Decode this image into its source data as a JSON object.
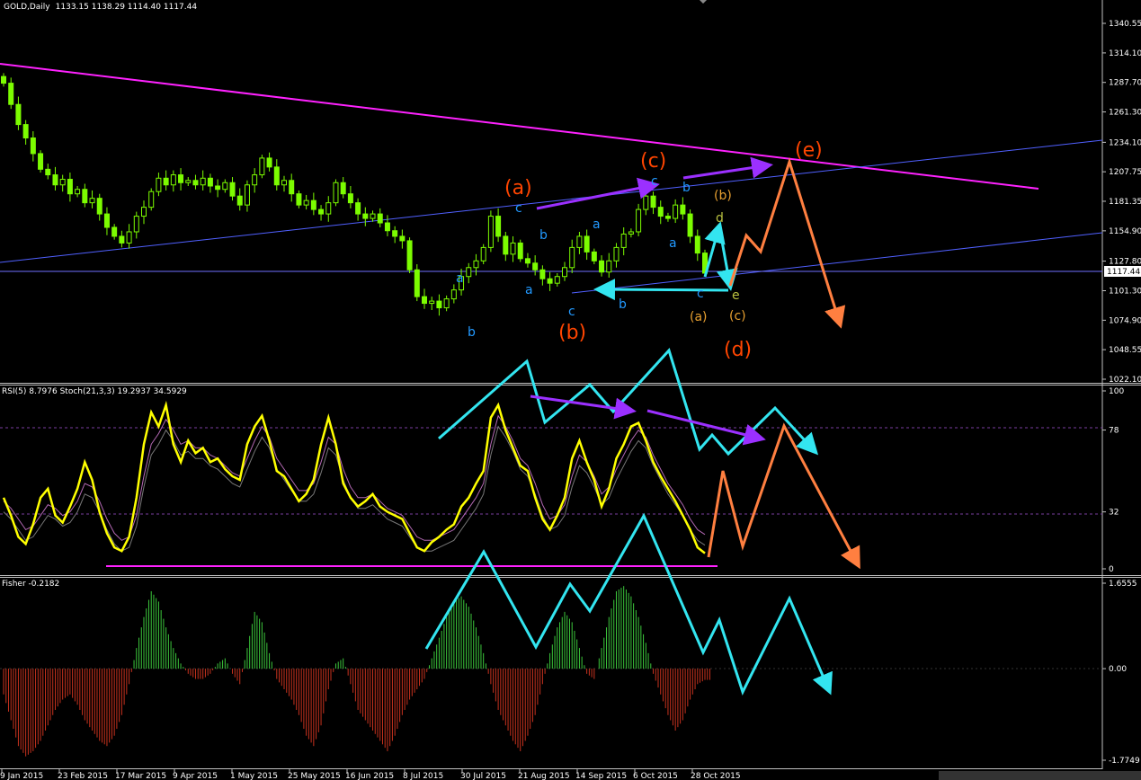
{
  "window": {
    "symbol": "GOLD,Daily",
    "ohlc": "1133.15 1138.29 1114.40 1117.44",
    "current_price": "1117.44"
  },
  "colors": {
    "background": "#000000",
    "frame": "#c0c0c0",
    "bull_candle": "#7cfc00",
    "rsi_line": "#ffff00",
    "stoch_line": "#b469b4",
    "fisher_pos": "#3cc83c",
    "fisher_neg": "#c8321e",
    "resistance_line": "#ff22ff",
    "channel_line": "#5060ff",
    "wave_main": "#ff4500",
    "wave_minor": "#2299ff",
    "wave_sub": "#e8a030",
    "wave_sub2": "#b8c040",
    "arrow_cyan": "#33e5f0",
    "arrow_orange": "#ff7f40",
    "arrow_purple": "#9b30ff"
  },
  "chart_data": [
    {
      "type": "candlestick",
      "title": "GOLD,Daily",
      "header_values": "1133.15 1138.29 1114.40 1117.44",
      "y_ticks": [
        "1340.55",
        "1314.10",
        "1287.70",
        "1261.30",
        "1234.10",
        "1207.75",
        "1181.35",
        "1154.90",
        "1127.80",
        "1101.30",
        "1074.90",
        "1048.55",
        "1022.10"
      ],
      "ylim": [
        1022.1,
        1340.55
      ],
      "current_price": 1117.44,
      "close_series": [
        1287,
        1268,
        1250,
        1238,
        1224,
        1210,
        1205,
        1196,
        1201,
        1188,
        1192,
        1180,
        1184,
        1170,
        1158,
        1150,
        1144,
        1154,
        1168,
        1176,
        1190,
        1202,
        1196,
        1205,
        1198,
        1200,
        1196,
        1202,
        1195,
        1192,
        1198,
        1186,
        1178,
        1196,
        1205,
        1220,
        1212,
        1196,
        1200,
        1188,
        1178,
        1182,
        1174,
        1170,
        1180,
        1198,
        1188,
        1180,
        1170,
        1166,
        1170,
        1162,
        1155,
        1150,
        1146,
        1120,
        1096,
        1090,
        1092,
        1086,
        1094,
        1102,
        1114,
        1122,
        1128,
        1140,
        1168,
        1150,
        1134,
        1144,
        1130,
        1126,
        1120,
        1112,
        1108,
        1114,
        1122,
        1140,
        1150,
        1136,
        1128,
        1118,
        1128,
        1140,
        1152,
        1154,
        1174,
        1186,
        1176,
        1168,
        1166,
        1178,
        1170,
        1150,
        1135,
        1117
      ],
      "wave_labels": [
        {
          "text": "(a)",
          "series": "primary"
        },
        {
          "text": "(b)",
          "series": "primary"
        },
        {
          "text": "(c)",
          "series": "primary"
        },
        {
          "text": "(d)",
          "series": "primary"
        },
        {
          "text": "(e)",
          "series": "primary"
        },
        {
          "text": "a",
          "series": "minor"
        },
        {
          "text": "b",
          "series": "minor"
        },
        {
          "text": "c",
          "series": "minor"
        },
        {
          "text": "a",
          "series": "minor"
        },
        {
          "text": "b",
          "series": "minor"
        },
        {
          "text": "c",
          "series": "minor"
        },
        {
          "text": "a",
          "series": "minor"
        },
        {
          "text": "b",
          "series": "minor"
        },
        {
          "text": "c",
          "series": "minor"
        },
        {
          "text": "a",
          "series": "minor"
        },
        {
          "text": "b",
          "series": "minor"
        },
        {
          "text": "c",
          "series": "minor"
        },
        {
          "text": "(a)",
          "series": "sub"
        },
        {
          "text": "(b)",
          "series": "sub"
        },
        {
          "text": "(c)",
          "series": "sub"
        },
        {
          "text": "d",
          "series": "sub2"
        },
        {
          "text": "e",
          "series": "sub2"
        }
      ]
    },
    {
      "type": "line",
      "title": "RSI(5) 8.7976  Stoch(21,3,3) 19.2937 34.5929",
      "y_ticks": [
        "100",
        "78",
        "32",
        "0"
      ],
      "ylim": [
        0,
        100
      ],
      "levels": [
        78,
        32
      ],
      "series": [
        {
          "name": "RSI(5)",
          "values": [
            40,
            30,
            18,
            14,
            25,
            40,
            45,
            30,
            26,
            35,
            45,
            60,
            50,
            32,
            20,
            12,
            10,
            18,
            40,
            70,
            88,
            80,
            92,
            70,
            60,
            72,
            65,
            68,
            60,
            62,
            56,
            52,
            50,
            70,
            80,
            86,
            72,
            55,
            52,
            45,
            38,
            42,
            50,
            70,
            85,
            70,
            48,
            40,
            35,
            38,
            42,
            35,
            32,
            30,
            28,
            20,
            12,
            10,
            15,
            18,
            22,
            25,
            35,
            40,
            48,
            55,
            85,
            92,
            78,
            68,
            58,
            55,
            40,
            28,
            22,
            30,
            40,
            62,
            72,
            60,
            50,
            35,
            45,
            62,
            70,
            80,
            82,
            72,
            60,
            52,
            45,
            38,
            30,
            22,
            12,
            8.8
          ]
        },
        {
          "name": "Stoch(21,3,3)",
          "values": [
            38,
            34,
            28,
            22,
            24,
            30,
            36,
            34,
            30,
            32,
            38,
            48,
            46,
            38,
            28,
            20,
            16,
            18,
            30,
            52,
            70,
            76,
            84,
            78,
            70,
            72,
            68,
            68,
            64,
            62,
            58,
            54,
            52,
            62,
            72,
            80,
            74,
            62,
            56,
            50,
            44,
            44,
            48,
            60,
            74,
            70,
            56,
            46,
            40,
            40,
            42,
            38,
            34,
            32,
            30,
            24,
            18,
            16,
            16,
            18,
            20,
            22,
            28,
            34,
            40,
            48,
            70,
            86,
            80,
            72,
            62,
            58,
            48,
            36,
            28,
            30,
            36,
            52,
            64,
            60,
            52,
            42,
            46,
            56,
            64,
            72,
            78,
            74,
            64,
            56,
            48,
            42,
            36,
            28,
            22,
            19.3
          ]
        }
      ],
      "marker_values": {
        "rsi": "8.7976",
        "stoch_main": "19.2937",
        "stoch_signal": "34.5929"
      }
    },
    {
      "type": "bar",
      "title": "Fisher -0.2182",
      "y_ticks": [
        "1.6555",
        "0.00",
        "-1.7749"
      ],
      "ylim": [
        -1.7749,
        1.6555
      ],
      "series": [
        {
          "name": "Fisher",
          "values": [
            -0.5,
            -1.0,
            -1.5,
            -1.7,
            -1.6,
            -1.4,
            -1.1,
            -0.8,
            -0.6,
            -0.5,
            -0.7,
            -1.0,
            -1.2,
            -1.4,
            -1.5,
            -1.3,
            -0.9,
            -0.3,
            0.4,
            1.0,
            1.5,
            1.3,
            0.8,
            0.4,
            0.1,
            -0.1,
            -0.2,
            -0.2,
            -0.1,
            0.1,
            0.2,
            -0.1,
            -0.3,
            0.4,
            1.1,
            0.9,
            0.3,
            -0.2,
            -0.4,
            -0.6,
            -0.9,
            -1.3,
            -1.5,
            -1.1,
            -0.4,
            0.1,
            0.2,
            -0.3,
            -0.8,
            -1.0,
            -1.2,
            -1.4,
            -1.6,
            -1.3,
            -0.9,
            -0.6,
            -0.4,
            -0.2,
            0.2,
            0.6,
            1.0,
            1.3,
            1.4,
            1.2,
            0.8,
            0.3,
            -0.3,
            -0.8,
            -1.1,
            -1.4,
            -1.6,
            -1.3,
            -0.9,
            -0.3,
            0.3,
            0.8,
            1.1,
            0.9,
            0.4,
            -0.1,
            -0.2,
            0.4,
            1.0,
            1.5,
            1.6,
            1.4,
            1.0,
            0.5,
            -0.1,
            -0.5,
            -0.9,
            -1.2,
            -1.0,
            -0.6,
            -0.3,
            -0.2182
          ]
        }
      ],
      "current_value": "-0.2182"
    }
  ],
  "x_axis": {
    "tick_labels": [
      "9 Jan 2015",
      "23 Feb 2015",
      "17 Mar 2015",
      "9 Apr 2015",
      "1 May 2015",
      "25 May 2015",
      "16 Jun 2015",
      "8 Jul 2015",
      "30 Jul 2015",
      "21 Aug 2015",
      "14 Sep 2015",
      "6 Oct 2015",
      "28 Oct 2015"
    ]
  }
}
